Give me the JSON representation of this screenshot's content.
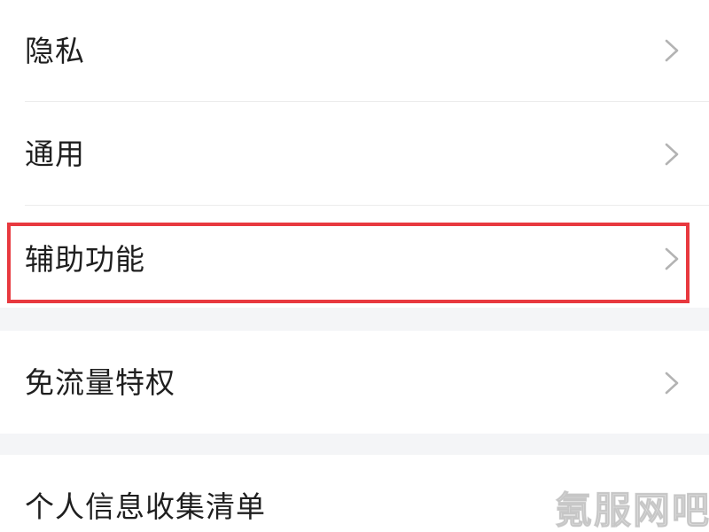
{
  "settings": {
    "items": [
      {
        "label": "隐私"
      },
      {
        "label": "通用"
      },
      {
        "label": "辅助功能"
      },
      {
        "label": "免流量特权"
      },
      {
        "label": "个人信息收集清单"
      }
    ]
  },
  "highlight_color": "#e8393f",
  "watermark": "氪服网吧",
  "icons": {
    "chevron": "chevron-right-icon"
  }
}
